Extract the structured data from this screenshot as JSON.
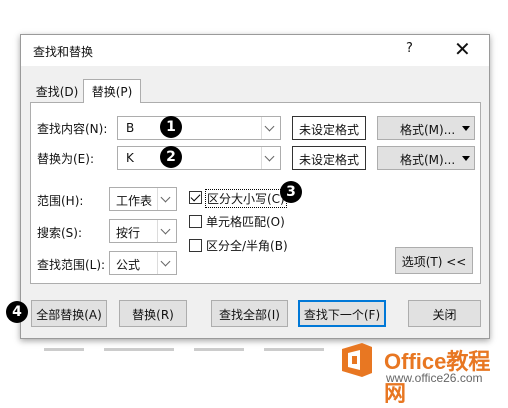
{
  "dialog": {
    "title": "查找和替换",
    "help": "?",
    "close": "✕"
  },
  "tabs": [
    {
      "label": "查找(D)",
      "accesskey": "D",
      "active": false
    },
    {
      "label": "替换(P)",
      "accesskey": "P",
      "active": true
    }
  ],
  "fields": {
    "find_label": "查找内容(N):",
    "find_value": "B",
    "find_format_status": "未设定格式",
    "replace_label": "替换为(E):",
    "replace_value": "K",
    "replace_format_status": "未设定格式",
    "format_button": "格式(M)..."
  },
  "options": {
    "within_label": "范围(H):",
    "within_value": "工作表",
    "search_label": "搜索(S):",
    "search_value": "按行",
    "lookin_label": "查找范围(L):",
    "lookin_value": "公式",
    "match_case_label": "区分大小写(C)",
    "match_case_checked": true,
    "match_entire_label": "单元格匹配(O)",
    "match_entire_checked": false,
    "match_byte_label": "区分全/半角(B)",
    "match_byte_checked": false,
    "options_button": "选项(T) <<"
  },
  "buttons": {
    "replace_all": "全部替换(A)",
    "replace": "替换(R)",
    "find_all": "查找全部(I)",
    "find_next": "查找下一个(F)",
    "close": "关闭"
  },
  "annotations": [
    "1",
    "2",
    "3",
    "4"
  ],
  "watermark": {
    "title": "Office教程网",
    "url": "www.office26.com"
  },
  "colors": {
    "dialog_bg": "#f0f0f0",
    "button_bg": "#e1e1e1",
    "focus_border": "#0078d7",
    "watermark_orange": "#e87722"
  }
}
